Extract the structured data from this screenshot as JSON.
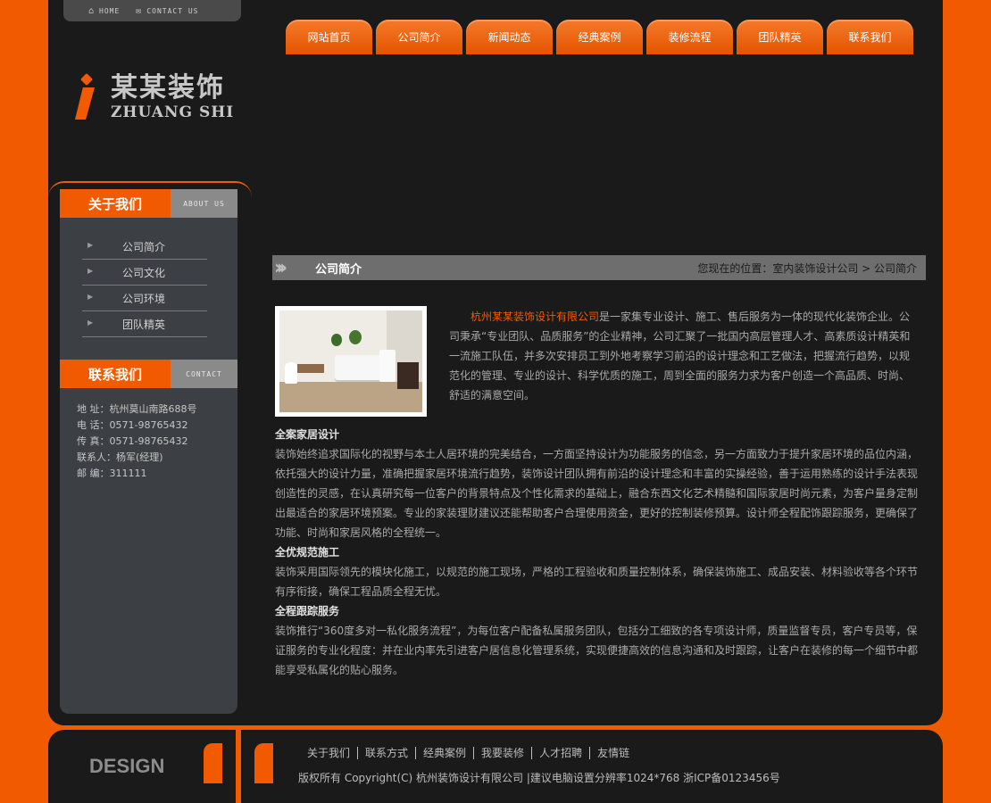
{
  "mini_nav": {
    "home": "HOME",
    "contact": "CONTACT US"
  },
  "logo": {
    "cn": "某某装饰",
    "en": "ZHUANG SHI"
  },
  "nav": {
    "tabs": [
      {
        "label": "网站首页"
      },
      {
        "label": "公司简介"
      },
      {
        "label": "新闻动态"
      },
      {
        "label": "经典案例"
      },
      {
        "label": "装修流程"
      },
      {
        "label": "团队精英"
      },
      {
        "label": "联系我们"
      }
    ]
  },
  "sidebar": {
    "about_title": "关于我们",
    "about_en": "ABOUT US",
    "items": [
      {
        "label": "公司简介"
      },
      {
        "label": "公司文化"
      },
      {
        "label": "公司环境"
      },
      {
        "label": "团队精英"
      }
    ],
    "contact_title": "联系我们",
    "contact_en": "CONTACT",
    "contact": {
      "address": "地  址：杭州莫山南路688号",
      "phone": "电  话：0571-98765432",
      "fax": "传  真：0571-98765432",
      "person": "联系人：杨军(经理)",
      "zip": "邮  编：311111"
    }
  },
  "breadcrumb": {
    "title": "公司简介",
    "location": "您现在的位置：室内装饰设计公司 > 公司简介"
  },
  "content": {
    "company": "杭州某某装饰设计有限公司",
    "intro": "是一家集专业设计、施工、售后服务为一体的现代化装饰企业。公司秉承“专业团队、品质服务”的企业精神，公司汇聚了一批国内高层管理人才、高素质设计精英和一流施工队伍，并多次安排员工到外地考察学习前沿的设计理念和工艺做法，把握流行趋势，以规范化的管理、专业的设计、科学优质的施工，周到全面的服务力求为客户创造一个高品质、时尚、舒适的满意空间。",
    "sections": [
      {
        "heading": "全案家居设计",
        "text": "装饰始终追求国际化的视野与本土人居环境的完美结合，一方面坚持设计为功能服务的信念，另一方面致力于提升家居环境的品位内涵，依托强大的设计力量，准确把握家居环境流行趋势，装饰设计团队拥有前沿的设计理念和丰富的实操经验，善于运用熟练的设计手法表现创造性的灵感，在认真研究每一位客户的背景特点及个性化需求的基础上，融合东西文化艺术精髓和国际家居时尚元素，为客户量身定制出最适合的家居环境预案。专业的家装理财建议还能帮助客户合理使用资金，更好的控制装修预算。设计师全程配饰跟踪服务，更确保了功能、时尚和家居风格的全程统一。"
      },
      {
        "heading": "全优规范施工",
        "text": "装饰采用国际领先的模块化施工，以规范的施工现场，严格的工程验收和质量控制体系，确保装饰施工、成品安装、材料验收等各个环节有序衔接，确保工程品质全程无忧。"
      },
      {
        "heading": "全程跟踪服务",
        "text": "装饰推行“360度多对一私化服务流程”，为每位客户配备私属服务团队，包括分工细致的各专项设计师，质量监督专员，客户专员等，保证服务的专业化程度：并在业内率先引进客户居信息化管理系统，实现便捷高效的信息沟通和及时跟踪，让客户在装修的每一个细节中都能享受私属化的贴心服务。"
      }
    ]
  },
  "footer": {
    "design": "DESIGN",
    "links": [
      {
        "label": "关于我们"
      },
      {
        "label": "联系方式"
      },
      {
        "label": "经典案例"
      },
      {
        "label": "我要装修"
      },
      {
        "label": "人才招聘"
      },
      {
        "label": "友情链"
      }
    ],
    "copyright": "版权所有 Copyright(C) 杭州装饰设计有限公司  |建议电脑设置分辨率1024*768 浙ICP备0123456号"
  },
  "colors": {
    "accent": "#f25a00",
    "background": "#1a1a1a",
    "sidebar": "#3c3f43"
  }
}
